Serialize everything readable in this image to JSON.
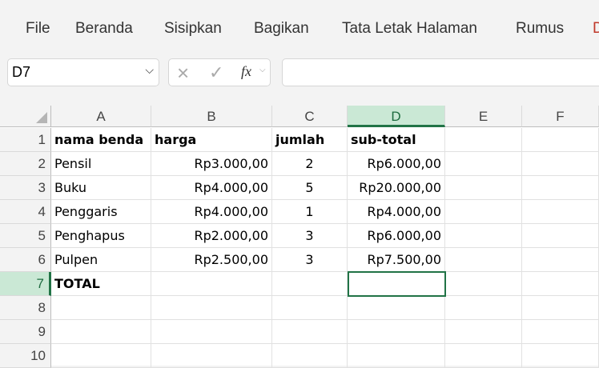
{
  "menu": [
    "File",
    "Beranda",
    "Sisipkan",
    "Bagikan",
    "Tata Letak Halaman",
    "Rumus",
    "D"
  ],
  "name_box": "D7",
  "formula_icons": {
    "cancel": "×",
    "enter": "✓",
    "fx": "fx"
  },
  "formula_value": "",
  "columns": [
    "A",
    "B",
    "C",
    "D",
    "E",
    "F"
  ],
  "rows": [
    "1",
    "2",
    "3",
    "4",
    "5",
    "6",
    "7",
    "8",
    "9",
    "10"
  ],
  "cells": [
    [
      "nama benda",
      "harga",
      "jumlah",
      "sub-total"
    ],
    [
      "Pensil",
      "Rp3.000,00",
      "2",
      "Rp6.000,00"
    ],
    [
      "Buku",
      "Rp4.000,00",
      "5",
      "Rp20.000,00"
    ],
    [
      "Penggaris",
      "Rp4.000,00",
      "1",
      "Rp4.000,00"
    ],
    [
      "Penghapus",
      "Rp2.000,00",
      "3",
      "Rp6.000,00"
    ],
    [
      "Pulpen",
      "Rp2.500,00",
      "3",
      "Rp7.500,00"
    ],
    [
      "TOTAL",
      "",
      "",
      ""
    ]
  ],
  "colors": {
    "accent": "#217346",
    "selected_header": "#cae8d5"
  }
}
